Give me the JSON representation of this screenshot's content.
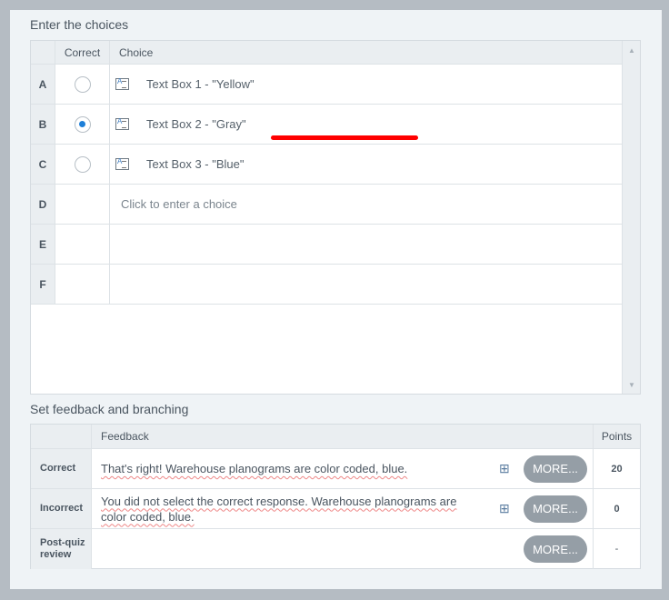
{
  "choices_section": {
    "title": "Enter the choices",
    "headers": {
      "correct": "Correct",
      "choice": "Choice"
    },
    "rows": [
      {
        "letter": "A",
        "text": "Text Box 1 - \"Yellow\"",
        "selected": false
      },
      {
        "letter": "B",
        "text": "Text Box 2 - \"Gray\"",
        "selected": true
      },
      {
        "letter": "C",
        "text": "Text Box 3 - \"Blue\"",
        "selected": false
      },
      {
        "letter": "D",
        "placeholder": "Click to enter a choice"
      },
      {
        "letter": "E"
      },
      {
        "letter": "F"
      }
    ]
  },
  "feedback_section": {
    "title": "Set feedback and branching",
    "headers": {
      "feedback": "Feedback",
      "points": "Points"
    },
    "more_label": "MORE...",
    "rows": [
      {
        "label": "Correct",
        "text": "That's right!  Warehouse planograms are color coded, blue.",
        "points": "20"
      },
      {
        "label": "Incorrect",
        "text": "You did not select the correct response.   Warehouse planograms are color coded, blue.",
        "points": "0"
      },
      {
        "label": "Post-quiz review",
        "text": "",
        "points": "-"
      }
    ]
  }
}
